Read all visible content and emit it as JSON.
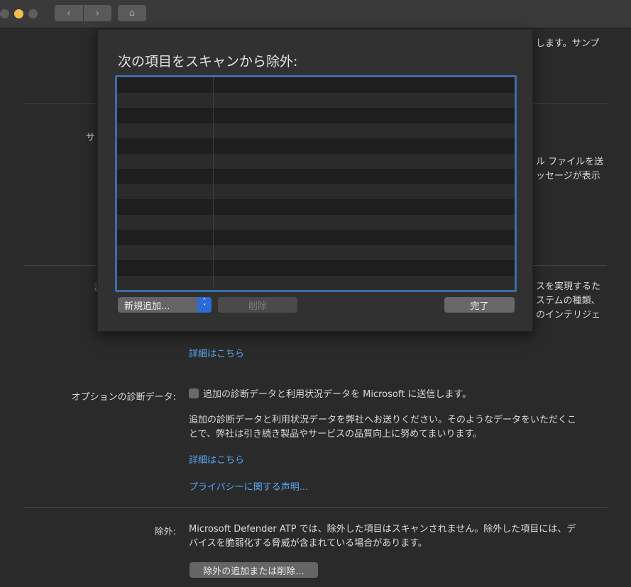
{
  "window": {
    "nav_back": "‹",
    "nav_forward": "›",
    "home_icon": "⌂"
  },
  "background": {
    "top_right_partial": "します。サンプ",
    "section2_left_partial": "サ",
    "section2_right_line1": "ル ファイルを送",
    "section2_right_line2": "ッセージが表示",
    "section3_left_partial": "ま",
    "section3_right_line1": "スを実現するた",
    "section3_right_line2": "ステムの種類、",
    "section3_right_line3": "のインテリジェ",
    "learn_more_1": "詳細はこちら",
    "optional_label": "オプションの診断データ:",
    "optional_checkbox_label": "追加の診断データと利用状況データを Microsoft に送信します。",
    "optional_desc_line1": "追加の診断データと利用状況データを弊社へお送りください。そのようなデータをいただくこ",
    "optional_desc_line2": "とで、弊社は引き続き製品やサービスの品質向上に努めてまいります。",
    "learn_more_2": "詳細はこちら",
    "privacy_link": "プライバシーに関する声明...",
    "exclusions_label": "除外:",
    "exclusions_desc_line1": "Microsoft Defender ATP では、除外した項目はスキャンされません。除外した項目には、デ",
    "exclusions_desc_line2": "バイスを脆弱化する脅威が含まれている場合があります。",
    "exclusions_button": "除外の追加または削除..."
  },
  "sheet": {
    "title": "次の項目をスキャンから除外:",
    "add_select_value": "新規追加...",
    "delete_button": "削除",
    "done_button": "完了"
  },
  "colors": {
    "accent": "#2b6ad7",
    "link": "#5aa7f5",
    "table_focus": "#3a6ea5"
  }
}
